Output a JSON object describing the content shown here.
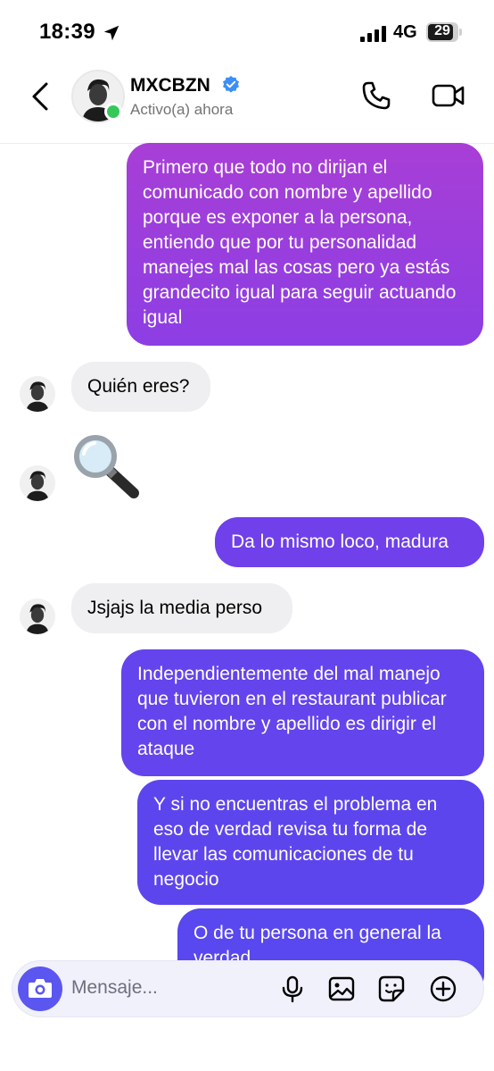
{
  "status_bar": {
    "time": "18:39",
    "network": "4G",
    "battery": "29"
  },
  "header": {
    "name": "MXCBZN",
    "status": "Activo(a) ahora"
  },
  "messages": [
    {
      "side": "out",
      "text": "Primero que todo no dirijan el comunicado con nombre y apellido porque es exponer a la persona, entiendo que por tu personalidad manejes mal las cosas pero ya estás grandecito igual para seguir actuando igual"
    },
    {
      "side": "in",
      "text": "Quién eres?"
    },
    {
      "side": "in",
      "emoji": "magnifying-glass"
    },
    {
      "side": "out",
      "text": "Da lo mismo loco, madura"
    },
    {
      "side": "in",
      "text": "Jsjajs la media perso"
    },
    {
      "side": "out",
      "text": "Independientemente del mal manejo que tuvieron en el restaurant publicar con el nombre y apellido es dirigir el ataque"
    },
    {
      "side": "out",
      "text": "Y si no encuentras el problema en eso de verdad revisa tu forma de llevar las comunicaciones de tu negocio"
    },
    {
      "side": "out",
      "text": "O de tu persona en general la verdad"
    }
  ],
  "composer": {
    "placeholder": "Mensaje..."
  },
  "colors": {
    "accent": "#5b56f0",
    "bubble_purple_top": "#a33fd9",
    "bubble_indigo": "#6243ee",
    "incoming_bg": "#efeff1",
    "online": "#35c759"
  }
}
